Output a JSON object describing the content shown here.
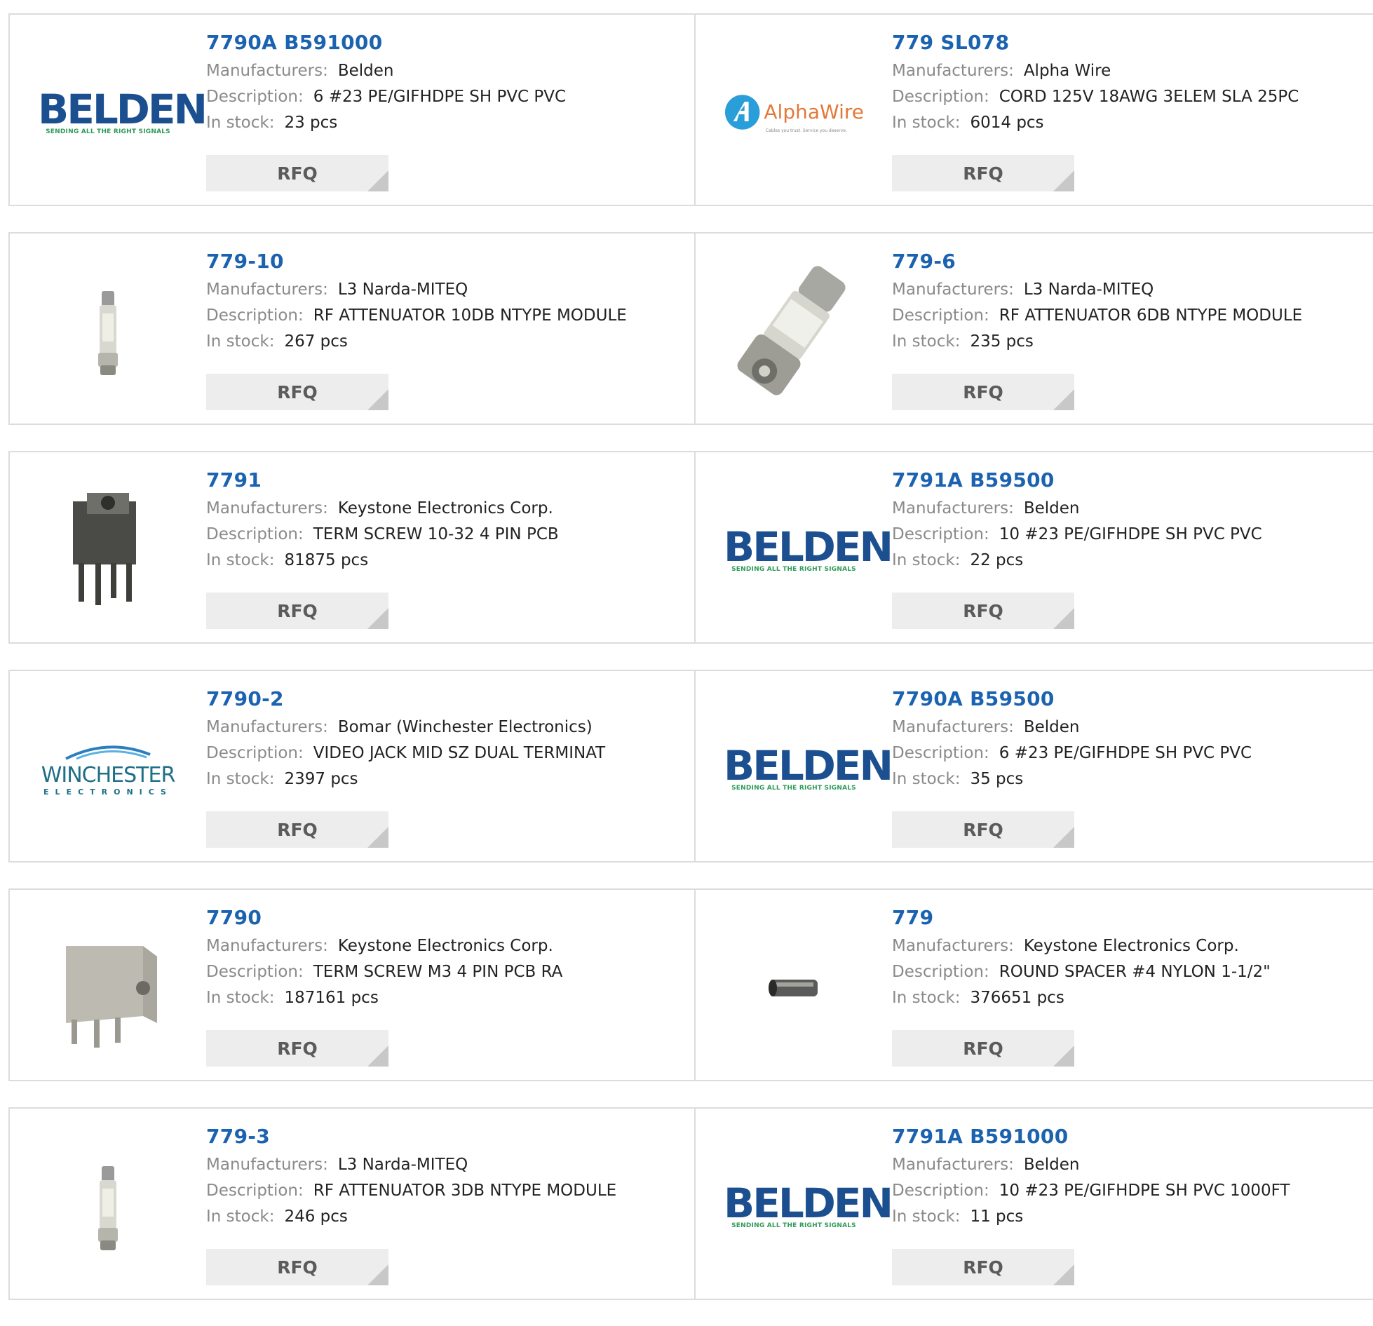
{
  "labels": {
    "manufacturers": "Manufacturers:",
    "description": "Description:",
    "stock": "In stock:",
    "rfq": "RFQ"
  },
  "logos": {
    "belden": {
      "name": "BELDEN",
      "tagline": "SENDING ALL THE RIGHT SIGNALS"
    },
    "alphawire": {
      "name": "AlphaWire",
      "tagline": "Cables you trust. Service you deserve."
    },
    "winchester": {
      "name": "WINCHESTER",
      "tagline": "ELECTRONICS"
    }
  },
  "colors": {
    "part_number": "#1b62b0",
    "belden_blue": "#1b4f8f",
    "belden_green": "#2e9a58",
    "alpha_orange": "#e2793a",
    "winchester_teal": "#1f6f86",
    "rfq_bg": "#ededed"
  },
  "products": [
    {
      "part": "7790A B591000",
      "manufacturer": "Belden",
      "description": "6 #23 PE/GIFHDPE SH PVC PVC",
      "stock": "23 pcs",
      "image": "belden-logo"
    },
    {
      "part": "779 SL078",
      "manufacturer": "Alpha Wire",
      "description": "CORD 125V 18AWG 3ELEM SLA 25PC",
      "stock": "6014 pcs",
      "image": "alphawire-logo"
    },
    {
      "part": "779-10",
      "manufacturer": "L3 Narda-MITEQ",
      "description": "RF ATTENUATOR 10DB NTYPE MODULE",
      "stock": "267 pcs",
      "image": "small-attenuator-photo"
    },
    {
      "part": "779-6",
      "manufacturer": "L3 Narda-MITEQ",
      "description": "RF ATTENUATOR 6DB NTYPE MODULE",
      "stock": "235 pcs",
      "image": "large-attenuator-photo"
    },
    {
      "part": "7791",
      "manufacturer": "Keystone Electronics Corp.",
      "description": "TERM SCREW 10-32 4 PIN PCB",
      "stock": "81875 pcs",
      "image": "dark-terminal-photo"
    },
    {
      "part": "7791A B59500",
      "manufacturer": "Belden",
      "description": "10 #23 PE/GIFHDPE SH PVC PVC",
      "stock": "22 pcs",
      "image": "belden-logo"
    },
    {
      "part": "7790-2",
      "manufacturer": "Bomar (Winchester Electronics)",
      "description": "VIDEO JACK MID SZ DUAL TERMINAT",
      "stock": "2397 pcs",
      "image": "winchester-logo"
    },
    {
      "part": "7790A B59500",
      "manufacturer": "Belden",
      "description": "6 #23 PE/GIFHDPE SH PVC PVC",
      "stock": "35 pcs",
      "image": "belden-logo"
    },
    {
      "part": "7790",
      "manufacturer": "Keystone Electronics Corp.",
      "description": "TERM SCREW M3 4 PIN PCB RA",
      "stock": "187161 pcs",
      "image": "silver-terminal-photo"
    },
    {
      "part": "779",
      "manufacturer": "Keystone Electronics Corp.",
      "description": "ROUND SPACER #4 NYLON 1-1/2\"",
      "stock": "376651 pcs",
      "image": "spacer-photo"
    },
    {
      "part": "779-3",
      "manufacturer": "L3 Narda-MITEQ",
      "description": "RF ATTENUATOR 3DB NTYPE MODULE",
      "stock": "246 pcs",
      "image": "small-attenuator-photo"
    },
    {
      "part": "7791A B591000",
      "manufacturer": "Belden",
      "description": "10 #23 PE/GIFHDPE SH PVC 1000FT",
      "stock": "11 pcs",
      "image": "belden-logo"
    }
  ]
}
